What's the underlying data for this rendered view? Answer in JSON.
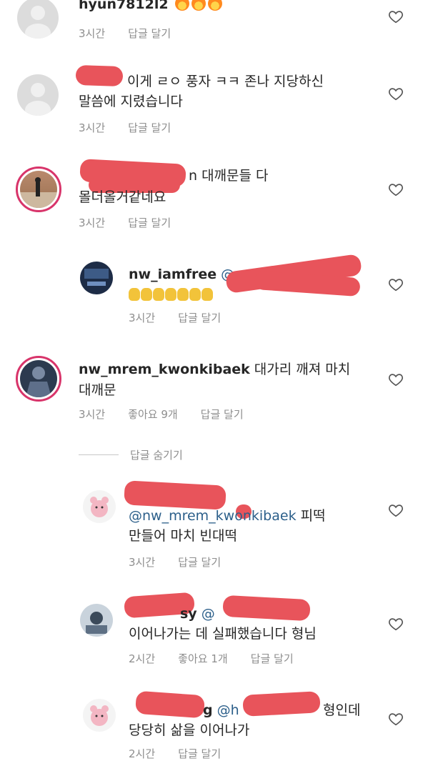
{
  "comments": [
    {
      "username": "hyun7812l2",
      "text": "",
      "time": "3시간",
      "reply": "답글 달기"
    },
    {
      "username": "",
      "text": "이게 ㄹㅇ 풍자 ㅋㅋ 존나 지당하신",
      "text2": "말씀에 지렸습니다",
      "time": "3시간",
      "reply": "답글 달기"
    },
    {
      "username": "",
      "text": "n 대깨문들 다",
      "text2": "몰더올거같네요",
      "time": "3시간",
      "reply": "답글 달기"
    },
    {
      "username": "nw_iamfree",
      "mention": "@",
      "time": "3시간",
      "reply": "답글 달기"
    },
    {
      "username": "nw_mrem_kwonkibaek",
      "text": "대가리 깨져 마치",
      "text2": "대깨문",
      "time": "3시간",
      "likes": "좋아요 9개",
      "reply": "답글 달기"
    },
    {
      "mention": "@nw_mrem_kwonkibaek",
      "text": "피떡",
      "text2": "만들어 마치 빈대떡",
      "time": "3시간",
      "reply": "답글 달기"
    },
    {
      "username": "sy",
      "mention": "@",
      "text2": "이어나가는 데 실패했습니다 형님",
      "time": "2시간",
      "likes": "좋아요 1개",
      "reply": "답글 달기"
    },
    {
      "username": "g",
      "mention": "@h",
      "text": "형인데",
      "text2": "당당히 삶을 이어나가",
      "time": "2시간",
      "reply": "답글 달기"
    }
  ],
  "hide_replies": "답글 숨기기",
  "colors": {
    "redaction": "#e8545b",
    "meta": "#8e8e8e",
    "mention": "#2c5f8a",
    "story_ring": "#d8346a"
  }
}
